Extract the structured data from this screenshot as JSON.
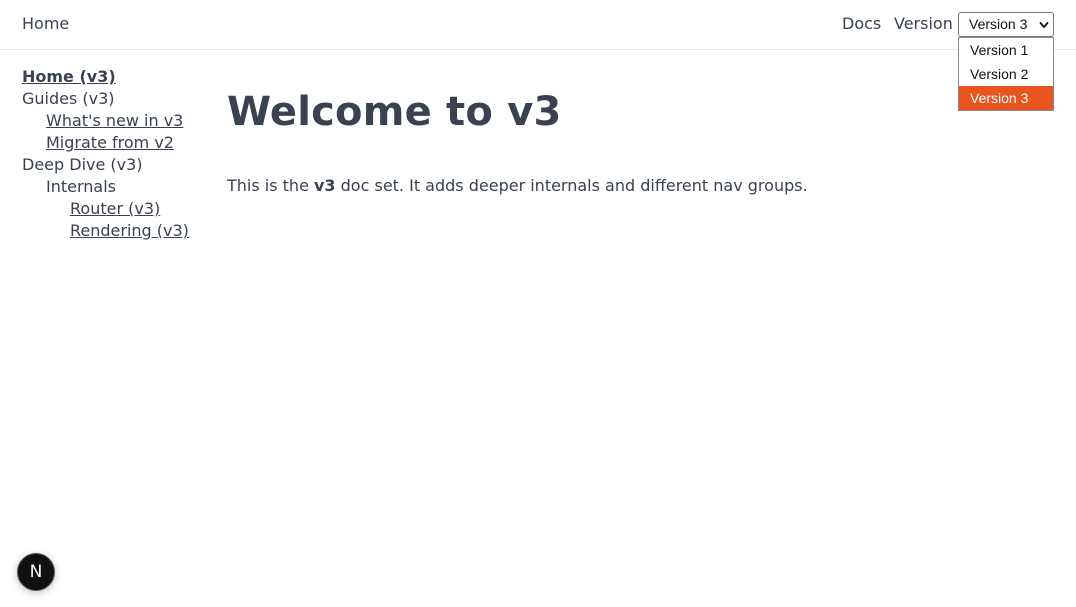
{
  "header": {
    "home": "Home",
    "docs": "Docs",
    "version_label": "Version",
    "version_selected": "Version 3",
    "version_options": [
      "Version 1",
      "Version 2",
      "Version 3"
    ],
    "accent_color": "#e95420"
  },
  "sidebar": {
    "items": [
      {
        "label": "Home (v3)"
      },
      {
        "label": "Guides (v3)"
      },
      {
        "label": "What's new in v3"
      },
      {
        "label": "Migrate from v2"
      },
      {
        "label": "Deep Dive (v3)"
      },
      {
        "label": "Internals"
      },
      {
        "label": "Router (v3)"
      },
      {
        "label": "Rendering (v3)"
      }
    ]
  },
  "main": {
    "title": "Welcome to v3",
    "intro_prefix": "This is the ",
    "intro_bold": "v3",
    "intro_suffix": " doc set. It adds deeper internals and different nav groups."
  },
  "badge": {
    "letter": "N"
  }
}
